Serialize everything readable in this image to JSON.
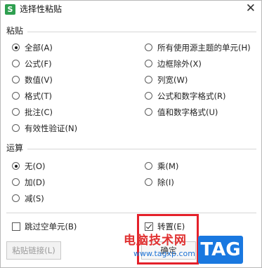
{
  "window": {
    "app_icon_letter": "S",
    "title": "选择性粘贴",
    "close_symbol": "✕"
  },
  "paste": {
    "title": "粘贴",
    "options": [
      {
        "label": "全部(A)",
        "checked": true
      },
      {
        "label": "所有使用源主题的单元(H)",
        "checked": false
      },
      {
        "label": "公式(F)",
        "checked": false
      },
      {
        "label": "边框除外(X)",
        "checked": false
      },
      {
        "label": "数值(V)",
        "checked": false
      },
      {
        "label": "列宽(W)",
        "checked": false
      },
      {
        "label": "格式(T)",
        "checked": false
      },
      {
        "label": "公式和数字格式(R)",
        "checked": false
      },
      {
        "label": "批注(C)",
        "checked": false
      },
      {
        "label": "值和数字格式(U)",
        "checked": false
      },
      {
        "label": "有效性验证(N)",
        "checked": false
      }
    ]
  },
  "operation": {
    "title": "运算",
    "options": [
      {
        "label": "无(O)",
        "checked": true
      },
      {
        "label": "乘(M)",
        "checked": false
      },
      {
        "label": "加(D)",
        "checked": false
      },
      {
        "label": "除(I)",
        "checked": false
      },
      {
        "label": "减(S)",
        "checked": false
      }
    ]
  },
  "checkboxes": {
    "skip_blanks": {
      "label": "跳过空单元(B)",
      "checked": false
    },
    "transpose": {
      "label": "转置(E)",
      "checked": true
    }
  },
  "buttons": {
    "paste_link": "粘贴链接(L)",
    "ok": "确定"
  },
  "watermark": {
    "site": "电脑技术网",
    "url": "www.tagxp.com",
    "tag": "TAG"
  },
  "colors": {
    "highlight_box": "#e4202a",
    "app_icon": "#2e9f4f",
    "tag_badge": "#1978e0"
  }
}
